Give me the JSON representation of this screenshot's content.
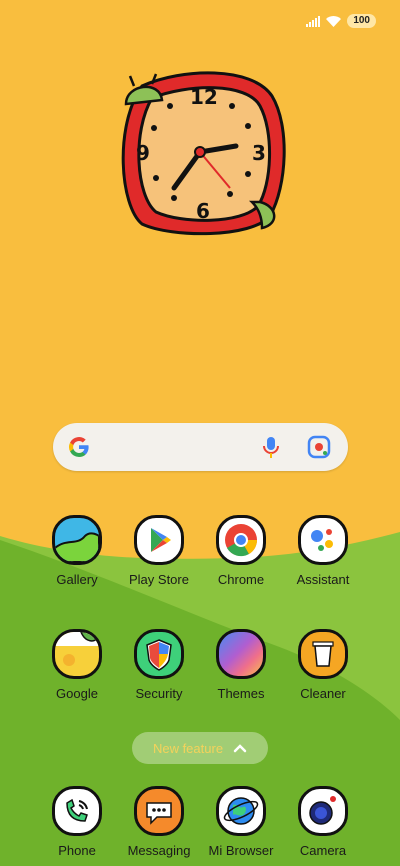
{
  "status_bar": {
    "battery": "100"
  },
  "clock_widget": {
    "numerals": [
      "12",
      "3",
      "6",
      "9"
    ]
  },
  "search": {
    "icons": [
      "google-g-icon",
      "mic-icon",
      "lens-icon"
    ]
  },
  "apps": [
    {
      "label": "Gallery"
    },
    {
      "label": "Play Store"
    },
    {
      "label": "Chrome"
    },
    {
      "label": "Assistant"
    },
    {
      "label": "Google"
    },
    {
      "label": "Security"
    },
    {
      "label": "Themes"
    },
    {
      "label": "Cleaner"
    }
  ],
  "new_feature_pill": {
    "label": "New feature"
  },
  "dock": [
    {
      "label": "Phone"
    },
    {
      "label": "Messaging"
    },
    {
      "label": "Mi Browser"
    },
    {
      "label": "Camera"
    }
  ],
  "colors": {
    "sky": "#F9BE3E",
    "hill_light": "#86C13A",
    "hill_dark": "#6DB22C"
  }
}
